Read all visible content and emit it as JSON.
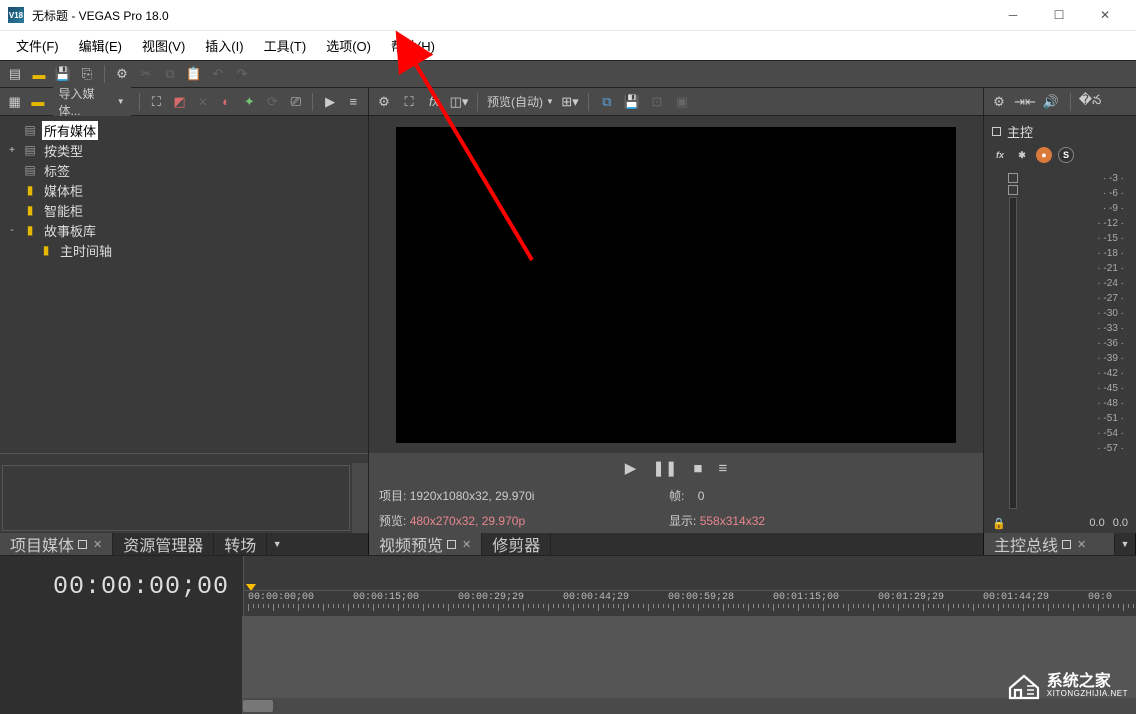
{
  "title": "无标题 - VEGAS Pro 18.0",
  "logo_text": "V18",
  "menu": [
    "文件(F)",
    "编辑(E)",
    "视图(V)",
    "插入(I)",
    "工具(T)",
    "选项(O)",
    "帮助(H)"
  ],
  "left_toolbar": {
    "import_label": "导入媒体..."
  },
  "tree": {
    "items": [
      {
        "label": "所有媒体",
        "icon": "stack",
        "selected": true,
        "exp": ""
      },
      {
        "label": "按类型",
        "icon": "stack",
        "exp": "+"
      },
      {
        "label": "标签",
        "icon": "stack",
        "exp": ""
      },
      {
        "label": "媒体柜",
        "icon": "folder",
        "exp": ""
      },
      {
        "label": "智能柜",
        "icon": "folder",
        "exp": ""
      },
      {
        "label": "故事板库",
        "icon": "folder",
        "exp": "-"
      },
      {
        "label": "主时间轴",
        "icon": "folder",
        "exp": "",
        "indent": 1
      }
    ]
  },
  "preview": {
    "dropdown": "预览(自动)",
    "project_label": "项目:",
    "project_value": "1920x1080x32, 29.970i",
    "preview_label": "预览:",
    "preview_value": "480x270x32, 29.970p",
    "frame_label": "帧:",
    "frame_value": "0",
    "display_label": "显示:",
    "display_value": "558x314x32"
  },
  "master": {
    "title": "主控",
    "scale": [
      "-3",
      "-6",
      "-9",
      "-12",
      "-15",
      "-18",
      "-21",
      "-24",
      "-27",
      "-30",
      "-33",
      "-36",
      "-39",
      "-42",
      "-45",
      "-48",
      "-51",
      "-54",
      "-57"
    ],
    "foot_l": "0.0",
    "foot_r": "0.0"
  },
  "dock": {
    "left": [
      {
        "label": "项目媒体",
        "active": true,
        "close": true
      },
      {
        "label": "资源管理器"
      },
      {
        "label": "转场"
      }
    ],
    "center": [
      {
        "label": "视频预览",
        "active": true,
        "close": true
      },
      {
        "label": "修剪器"
      }
    ],
    "right": [
      {
        "label": "主控总线",
        "active": true,
        "close": true
      }
    ]
  },
  "timeline": {
    "counter": "00:00:00;00",
    "marks": [
      "00:00:00;00",
      "00:00:15;00",
      "00:00:29;29",
      "00:00:44;29",
      "00:00:59;28",
      "00:01:15;00",
      "00:01:29;29",
      "00:01:44;29",
      "00:0"
    ]
  },
  "watermark": {
    "cn": "系统之家",
    "en": "XITONGZHIJIA.NET"
  }
}
